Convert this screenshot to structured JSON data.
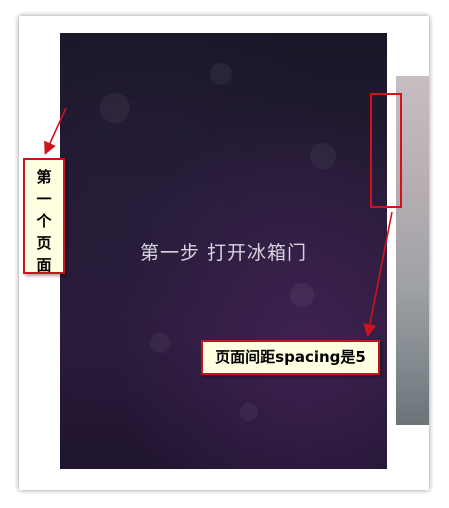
{
  "pages": {
    "main_title": "第一步 打开冰箱门"
  },
  "annotations": {
    "first_page_label": [
      "第",
      "一",
      "个",
      "页",
      "面"
    ],
    "spacing_label": "页面间距spacing是5"
  },
  "colors": {
    "annotation_red": "#d0121b",
    "callout_bg": "#ffffe1"
  }
}
